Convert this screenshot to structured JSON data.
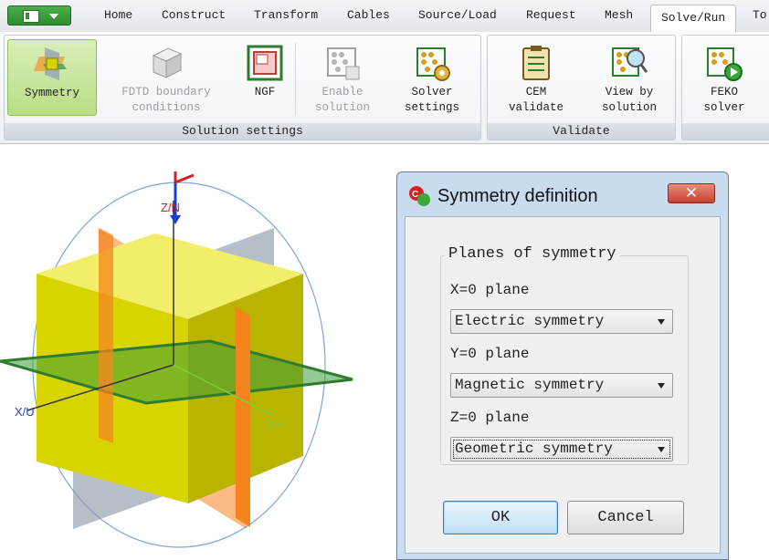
{
  "tabs": [
    "Home",
    "Construct",
    "Transform",
    "Cables",
    "Source/Load",
    "Request",
    "Mesh",
    "Solve/Run",
    "To"
  ],
  "active_tab": "Solve/Run",
  "ribbon": {
    "solution_settings": {
      "label": "Solution settings",
      "buttons": [
        {
          "label": "Symmetry",
          "state": "selected"
        },
        {
          "label": "FDTD boundary\nconditions",
          "state": "disabled"
        },
        {
          "label": "NGF",
          "state": "enabled"
        },
        {
          "label": "Enable\nsolution",
          "state": "disabled"
        },
        {
          "label": "Solver\nsettings",
          "state": "enabled"
        }
      ]
    },
    "validate": {
      "label": "Validate",
      "buttons": [
        {
          "label": "CEM\nvalidate",
          "state": "enabled"
        },
        {
          "label": "View by\nsolution",
          "state": "enabled"
        }
      ]
    },
    "run": {
      "buttons": [
        {
          "label": "FEKO\nsolver",
          "state": "enabled"
        }
      ]
    }
  },
  "scene": {
    "axis_z": "Z/N",
    "axis_x": "X/U",
    "axis_y": "Y/V"
  },
  "dialog": {
    "title": "Symmetry definition",
    "close_label": "✕",
    "group_label": "Planes of symmetry",
    "fields": [
      {
        "label": "X=0 plane",
        "value": "Electric symmetry"
      },
      {
        "label": "Y=0 plane",
        "value": "Magnetic symmetry"
      },
      {
        "label": "Z=0 plane",
        "value": "Geometric symmetry"
      }
    ],
    "ok_label": "OK",
    "cancel_label": "Cancel"
  },
  "colors": {
    "x_plane": "#f5841f",
    "y_plane": "#8593a3",
    "z_plane": "#3d9c3d",
    "cube": "#d8d400"
  }
}
